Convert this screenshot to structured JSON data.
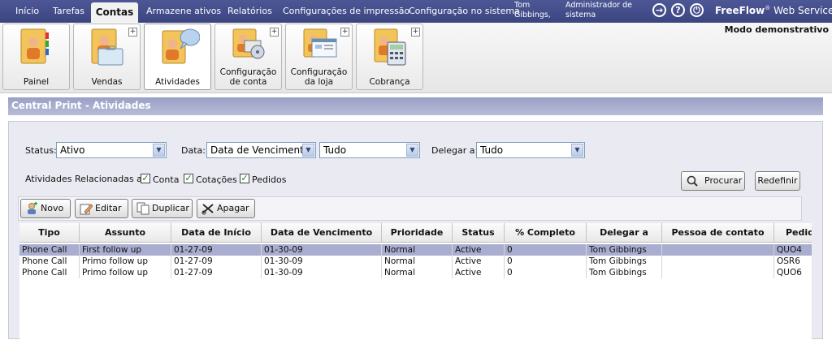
{
  "nav": {
    "items": [
      "Início",
      "Tarefas",
      "Contas",
      "Armazene ativos",
      "Relatórios",
      "Configurações de impressão",
      "Configuração no sistema"
    ],
    "active": "Contas",
    "user_name": "Tom Gibbings,",
    "user_role": "Administrador de sistema",
    "brand_bold": "FreeFlow",
    "brand_reg": "®",
    "brand_rest": " Web Services",
    "colors": {
      "nav_bg": "#3b4580",
      "title_bar": "#9aa0c6"
    }
  },
  "toolbar": {
    "demo_mode": "Modo demonstrativo",
    "tiles": [
      {
        "label": "Painel",
        "icon": "folder-person-icon",
        "plus": false,
        "selected": false
      },
      {
        "label": "Vendas",
        "icon": "briefcase-icon",
        "plus": true,
        "selected": false
      },
      {
        "label": "Atividades",
        "icon": "chat-bubble-icon",
        "plus": false,
        "selected": true
      },
      {
        "label": "Configuração de conta",
        "icon": "gear-disc-icon",
        "plus": true,
        "selected": false
      },
      {
        "label": "Configuração da loja",
        "icon": "store-window-icon",
        "plus": true,
        "selected": false
      },
      {
        "label": "Cobrança",
        "icon": "calculator-icon",
        "plus": true,
        "selected": false
      }
    ]
  },
  "page_title": "Central Print - Atividades",
  "filters": {
    "status_label": "Status:",
    "status_value": "Ativo",
    "date_label": "Data:",
    "date_type_value": "Data de Vencimento",
    "date_range_value": "Tudo",
    "delegate_label": "Delegar a:",
    "delegate_value": "Tudo",
    "related_label": "Atividades Relacionadas a:",
    "related": [
      {
        "label": "Conta",
        "checked": true
      },
      {
        "label": "Cotações",
        "checked": true
      },
      {
        "label": "Pedidos",
        "checked": true
      }
    ],
    "search_button": "Procurar",
    "reset_button": "Redefinir"
  },
  "actions": {
    "new": "Novo",
    "edit": "Editar",
    "duplicate": "Duplicar",
    "delete": "Apagar"
  },
  "table": {
    "columns": [
      "Tipo",
      "Assunto",
      "Data de Início",
      "Data de Vencimento",
      "Prioridade",
      "Status",
      "% Completo",
      "Delegar a",
      "Pessoa de contato",
      "Pedido"
    ],
    "rows": [
      [
        "Phone Call",
        "First follow up",
        "01-27-09",
        "01-30-09",
        "Normal",
        "Active",
        "0",
        "Tom Gibbings",
        "",
        "QUO4"
      ],
      [
        "Phone Call",
        "Primo follow up",
        "01-27-09",
        "01-30-09",
        "Normal",
        "Active",
        "0",
        "Tom Gibbings",
        "",
        "OSR6"
      ],
      [
        "Phone Call",
        "Primo follow up",
        "01-27-09",
        "01-30-09",
        "Normal",
        "Active",
        "0",
        "Tom Gibbings",
        "",
        "QUO6"
      ]
    ],
    "selected_row": 0
  }
}
